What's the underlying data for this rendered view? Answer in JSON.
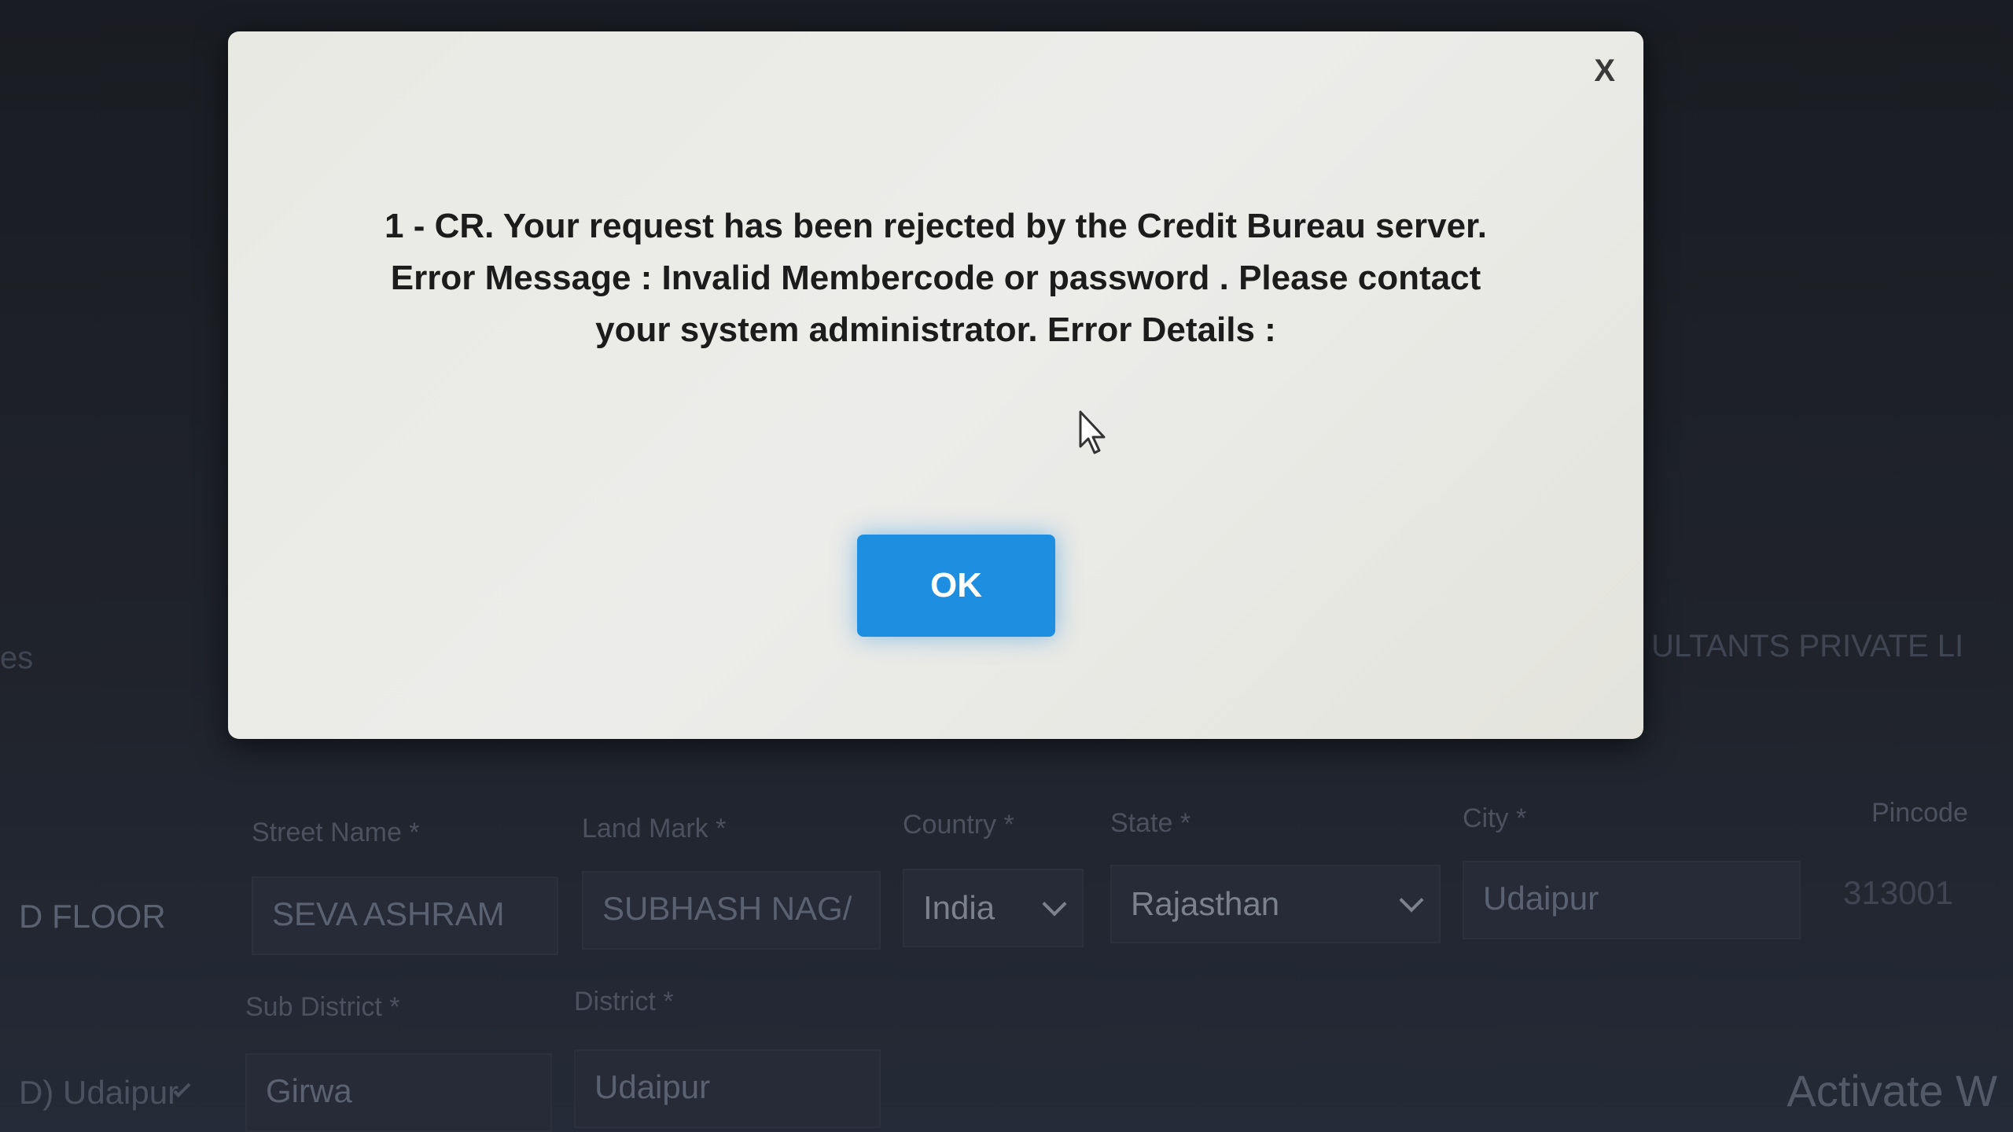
{
  "background_form": {
    "left_heading_fragment": "es",
    "right_heading_fragment": "ULTANTS PRIVATE LI",
    "row1": {
      "left_value_fragment": "D FLOOR",
      "street_name": {
        "label": "Street Name *",
        "value": "SEVA ASHRAM"
      },
      "land_mark": {
        "label": "Land Mark *",
        "value": "SUBHASH NAG/"
      },
      "country": {
        "label": "Country *",
        "value": "India"
      },
      "state": {
        "label": "State *",
        "value": "Rajasthan"
      },
      "city": {
        "label": "City *",
        "value": "Udaipur"
      },
      "pincode": {
        "label": "Pincode",
        "value": "313001"
      }
    },
    "row2": {
      "left_value_fragment": "D) Udaipur",
      "sub_district": {
        "label": "Sub District *",
        "value": "Girwa"
      },
      "district": {
        "label": "District *",
        "value": "Udaipur"
      }
    },
    "watermark": "Activate W"
  },
  "dialog": {
    "close_label": "X",
    "message_lines": [
      "1 - CR. Your request has been rejected by the Credit Bureau server.",
      "Error Message : Invalid Membercode or password . Please contact",
      "your system administrator. Error Details :"
    ],
    "ok_label": "OK"
  },
  "colors": {
    "ok_button": "#1e8fe0",
    "dialog_bg": "#eaeae6"
  }
}
